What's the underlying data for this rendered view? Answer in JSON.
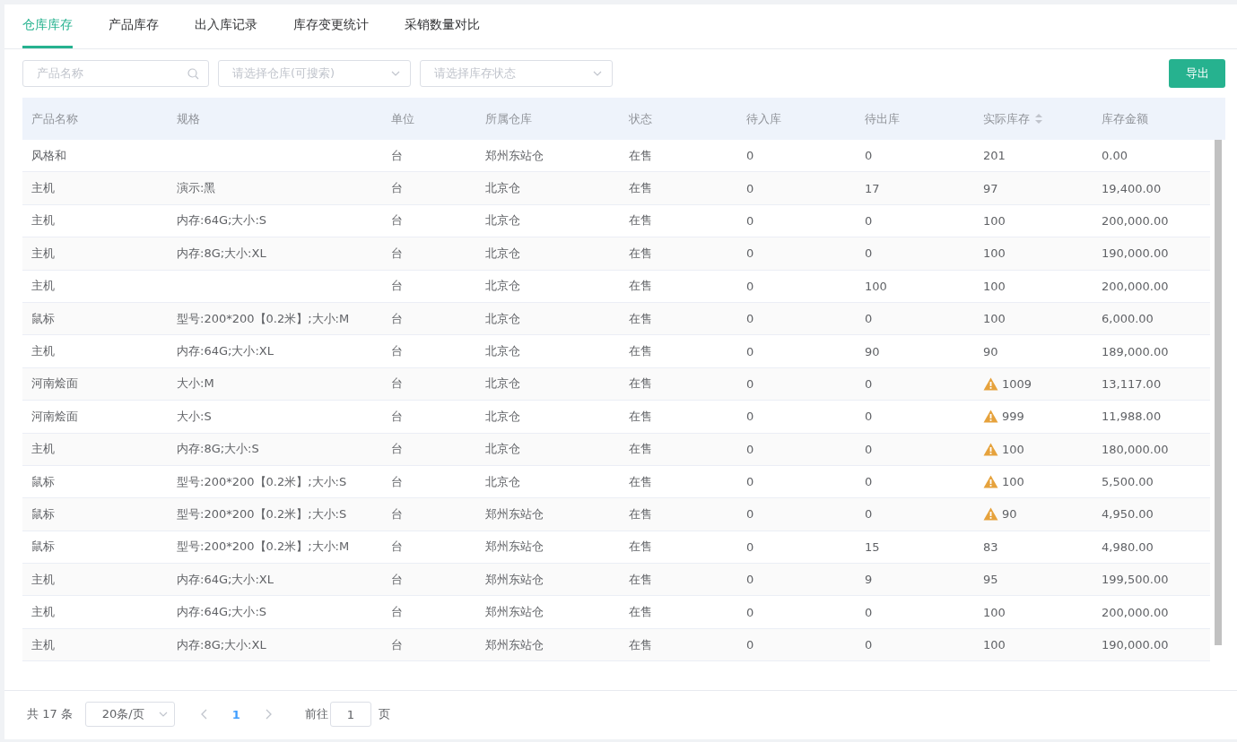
{
  "tabs": [
    {
      "label": "仓库库存",
      "selected": true
    },
    {
      "label": "产品库存",
      "selected": false
    },
    {
      "label": "出入库记录",
      "selected": false
    },
    {
      "label": "库存变更统计",
      "selected": false
    },
    {
      "label": "采销数量对比",
      "selected": false
    }
  ],
  "filters": [
    {
      "kind": "search",
      "placeholder": "产品名称"
    },
    {
      "kind": "select",
      "placeholder": "请选择仓库(可搜索)"
    },
    {
      "kind": "select",
      "placeholder": "请选择库存状态"
    }
  ],
  "export_button": "导出",
  "table": {
    "columns": [
      {
        "label": "产品名称",
        "sortable": false
      },
      {
        "label": "规格",
        "sortable": false
      },
      {
        "label": "单位",
        "sortable": false
      },
      {
        "label": "所属仓库",
        "sortable": false
      },
      {
        "label": "状态",
        "sortable": false
      },
      {
        "label": "待入库",
        "sortable": false
      },
      {
        "label": "待出库",
        "sortable": false
      },
      {
        "label": "实际库存",
        "sortable": true
      },
      {
        "label": "库存金额",
        "sortable": false
      }
    ],
    "rows": [
      {
        "cells": [
          "风格和",
          "",
          "台",
          "郑州东站仓",
          "在售",
          "0",
          "0",
          "201",
          "0.00"
        ],
        "warning": false
      },
      {
        "cells": [
          "主机",
          "演示:黑",
          "台",
          "北京仓",
          "在售",
          "0",
          "17",
          "97",
          "19,400.00"
        ],
        "warning": false
      },
      {
        "cells": [
          "主机",
          "内存:64G;大小:S",
          "台",
          "北京仓",
          "在售",
          "0",
          "0",
          "100",
          "200,000.00"
        ],
        "warning": false
      },
      {
        "cells": [
          "主机",
          "内存:8G;大小:XL",
          "台",
          "北京仓",
          "在售",
          "0",
          "0",
          "100",
          "190,000.00"
        ],
        "warning": false
      },
      {
        "cells": [
          "主机",
          "",
          "台",
          "北京仓",
          "在售",
          "0",
          "100",
          "100",
          "200,000.00"
        ],
        "warning": false
      },
      {
        "cells": [
          "鼠标",
          "型号:200*200【0.2米】;大小:M",
          "台",
          "北京仓",
          "在售",
          "0",
          "0",
          "100",
          "6,000.00"
        ],
        "warning": false
      },
      {
        "cells": [
          "主机",
          "内存:64G;大小:XL",
          "台",
          "北京仓",
          "在售",
          "0",
          "90",
          "90",
          "189,000.00"
        ],
        "warning": false
      },
      {
        "cells": [
          "河南烩面",
          "大小:M",
          "台",
          "北京仓",
          "在售",
          "0",
          "0",
          "1009",
          "13,117.00"
        ],
        "warning": true
      },
      {
        "cells": [
          "河南烩面",
          "大小:S",
          "台",
          "北京仓",
          "在售",
          "0",
          "0",
          "999",
          "11,988.00"
        ],
        "warning": true
      },
      {
        "cells": [
          "主机",
          "内存:8G;大小:S",
          "台",
          "北京仓",
          "在售",
          "0",
          "0",
          "100",
          "180,000.00"
        ],
        "warning": true
      },
      {
        "cells": [
          "鼠标",
          "型号:200*200【0.2米】;大小:S",
          "台",
          "北京仓",
          "在售",
          "0",
          "0",
          "100",
          "5,500.00"
        ],
        "warning": true
      },
      {
        "cells": [
          "鼠标",
          "型号:200*200【0.2米】;大小:S",
          "台",
          "郑州东站仓",
          "在售",
          "0",
          "0",
          "90",
          "4,950.00"
        ],
        "warning": true
      },
      {
        "cells": [
          "鼠标",
          "型号:200*200【0.2米】;大小:M",
          "台",
          "郑州东站仓",
          "在售",
          "0",
          "15",
          "83",
          "4,980.00"
        ],
        "warning": false
      },
      {
        "cells": [
          "主机",
          "内存:64G;大小:XL",
          "台",
          "郑州东站仓",
          "在售",
          "0",
          "9",
          "95",
          "199,500.00"
        ],
        "warning": false
      },
      {
        "cells": [
          "主机",
          "内存:64G;大小:S",
          "台",
          "郑州东站仓",
          "在售",
          "0",
          "0",
          "100",
          "200,000.00"
        ],
        "warning": false
      },
      {
        "cells": [
          "主机",
          "内存:8G;大小:XL",
          "台",
          "郑州东站仓",
          "在售",
          "0",
          "0",
          "100",
          "190,000.00"
        ],
        "warning": false
      }
    ]
  },
  "pagination": {
    "total": "共 17 条",
    "page_size": "20条/页",
    "pages": [
      {
        "label": "1",
        "selected": true
      }
    ],
    "goto_label": "前往",
    "goto_value": "1",
    "goto_suffix": "页"
  }
}
